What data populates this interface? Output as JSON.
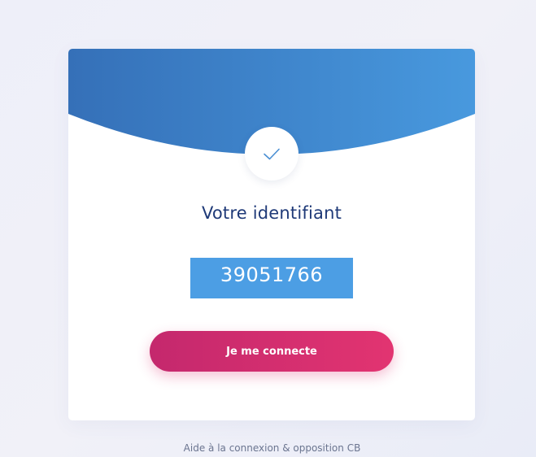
{
  "card": {
    "title": "Votre identifiant",
    "identifier": "39051766",
    "connect_button_label": "Je me connecte"
  },
  "footer": {
    "help_link_label": "Aide à la connexion & opposition CB"
  },
  "icons": {
    "status": "check-icon"
  },
  "colors": {
    "header_gradient_start": "#3570b8",
    "header_gradient_end": "#4899de",
    "title": "#1f3a78",
    "identifier_background": "#4c9ee4",
    "button_gradient_start": "#c4286d",
    "button_gradient_end": "#e23471"
  }
}
